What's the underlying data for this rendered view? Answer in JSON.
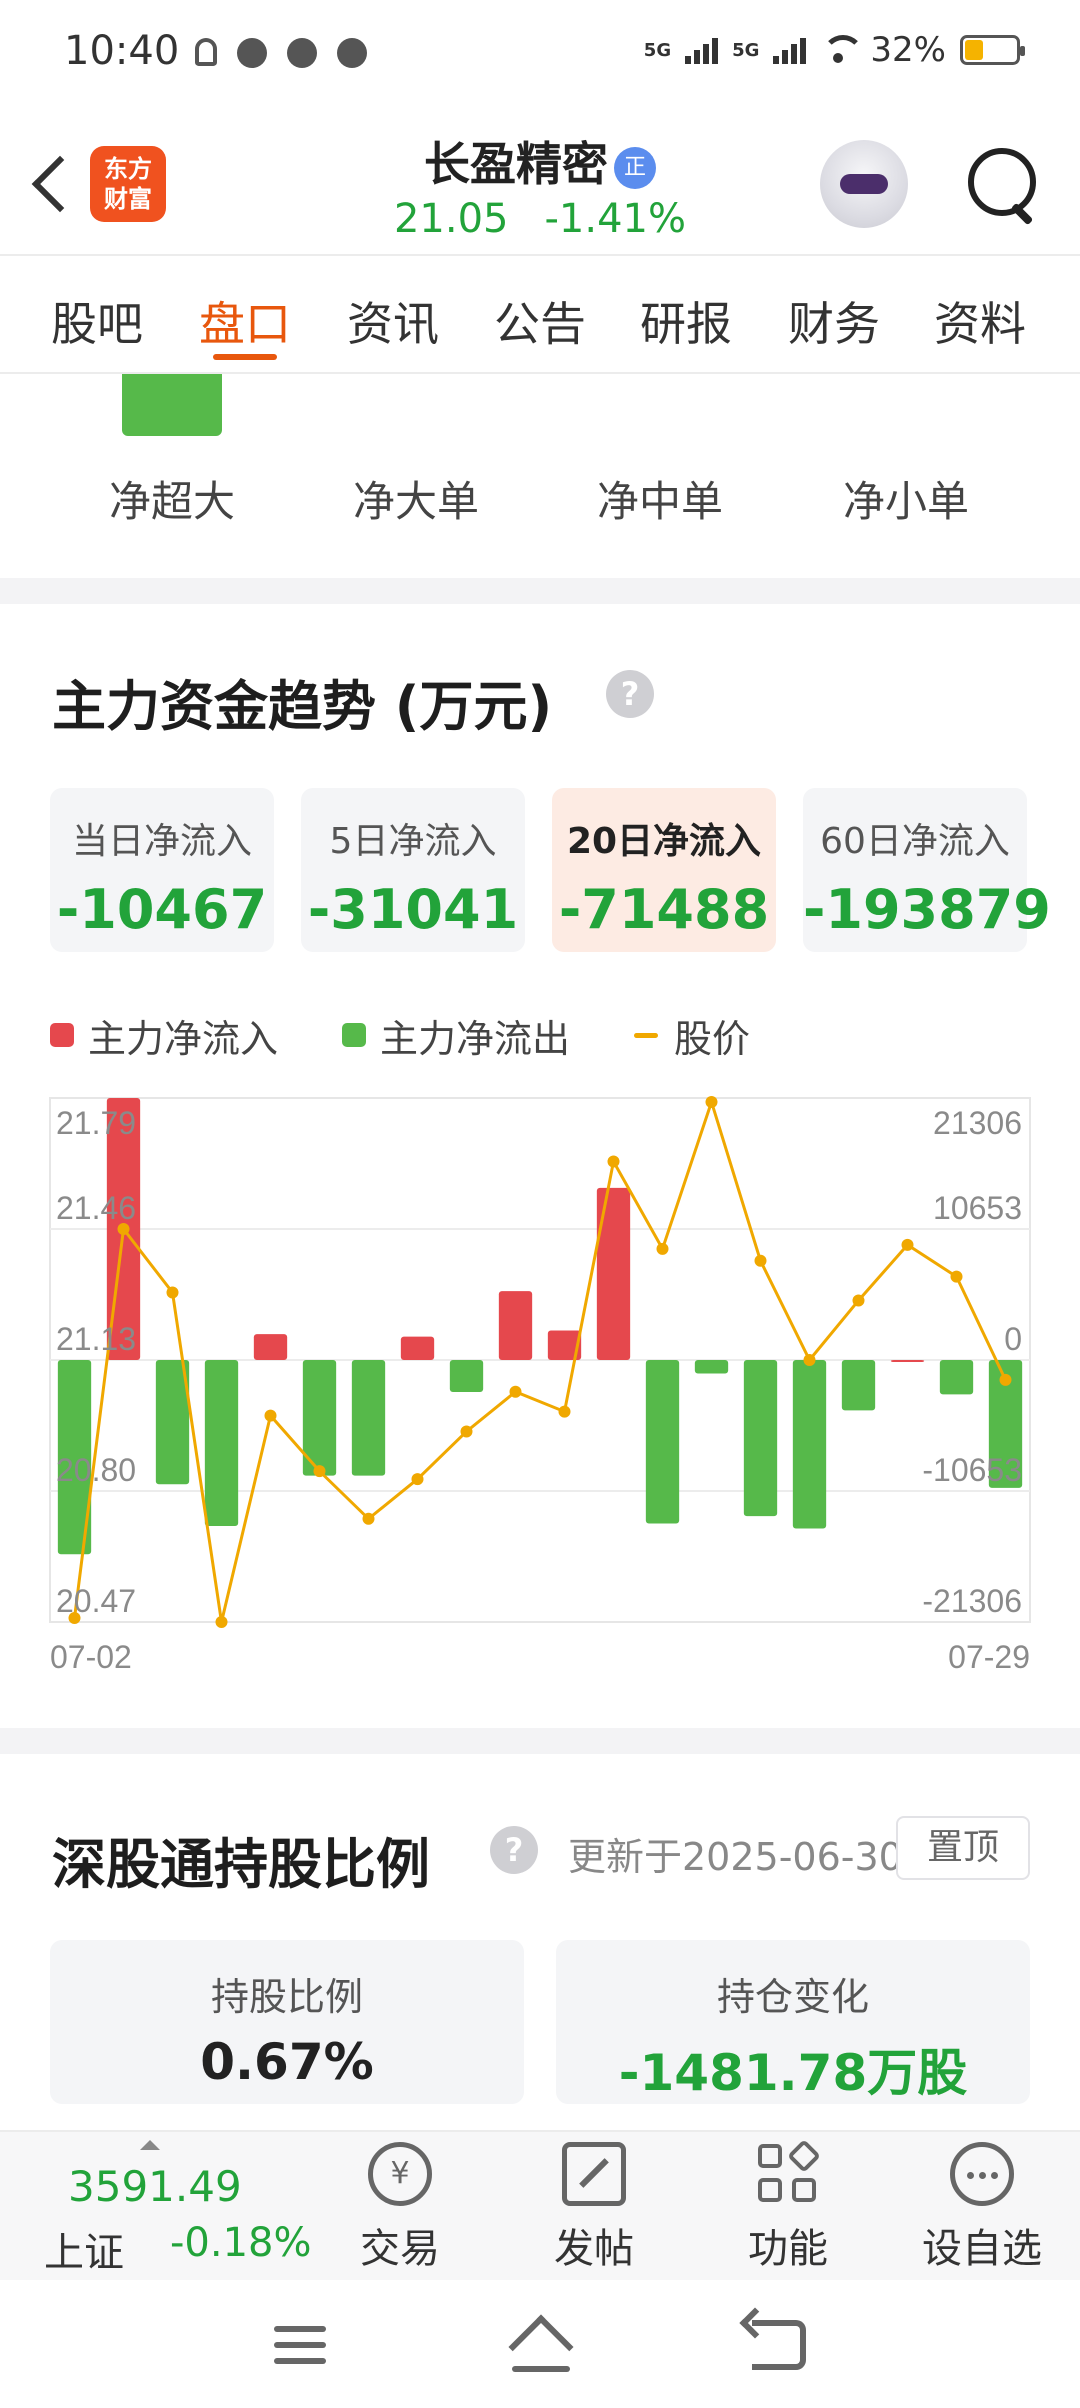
{
  "status_bar": {
    "time": "10:40",
    "signal1": "5G",
    "signal2": "5G",
    "battery": "32%"
  },
  "header": {
    "logo_text_line1": "东方",
    "logo_text_line2": "财富",
    "stock_name": "长盈精密",
    "badge": "正",
    "price": "21.05",
    "change_pct": "-1.41%"
  },
  "tabs": [
    {
      "label": "股吧"
    },
    {
      "label": "盘口"
    },
    {
      "label": "资讯"
    },
    {
      "label": "公告"
    },
    {
      "label": "研报"
    },
    {
      "label": "财务"
    },
    {
      "label": "资料"
    }
  ],
  "active_tab": "盘口",
  "flow_labels": [
    "净超大",
    "净大单",
    "净中单",
    "净小单"
  ],
  "trend": {
    "title": "主力资金趋势 (万元)",
    "help": "?",
    "cards": [
      {
        "label": "当日净流入",
        "value": "-10467"
      },
      {
        "label": "5日净流入",
        "value": "-31041"
      },
      {
        "label": "20日净流入",
        "value": "-71488"
      },
      {
        "label": "60日净流入",
        "value": "-193879"
      }
    ],
    "active_card": "20日净流入",
    "legend": [
      {
        "label": "主力净流入",
        "color": "#e5484d"
      },
      {
        "label": "主力净流出",
        "color": "#56b94a"
      },
      {
        "label": "股价",
        "color": "#f0a800"
      }
    ]
  },
  "chart_data": {
    "type": "bar",
    "x_start_label": "07-02",
    "x_end_label": "07-29",
    "left_ticks": [
      "21.79",
      "21.46",
      "21.13",
      "20.80",
      "20.47"
    ],
    "right_ticks": [
      "21306",
      "10653",
      "0",
      "-10653",
      "-21306"
    ],
    "ylim_flow": [
      -21306,
      21306
    ],
    "ylim_price": [
      20.47,
      21.79
    ],
    "series": [
      {
        "name": "主力净流入/主力净流出",
        "values": [
          -15800,
          21306,
          -10100,
          -13500,
          2100,
          -9400,
          -9400,
          1900,
          -2600,
          5600,
          2400,
          14000,
          -13300,
          -1100,
          -12700,
          -13700,
          -4100,
          0,
          -2800,
          -10400
        ]
      },
      {
        "name": "股价",
        "values": [
          20.48,
          21.46,
          21.3,
          20.47,
          20.99,
          20.85,
          20.73,
          20.83,
          20.95,
          21.05,
          21.0,
          21.63,
          21.41,
          21.78,
          21.38,
          21.13,
          21.28,
          21.42,
          21.34,
          21.08
        ]
      }
    ]
  },
  "holdings": {
    "title": "深股通持股比例",
    "help": "?",
    "updated": "更新于2025-06-30",
    "pin": "置顶",
    "ratio_label": "持股比例",
    "ratio_value": "0.67%",
    "change_label": "持仓变化",
    "change_value": "-1481.78万股"
  },
  "bottom_bar": {
    "index_value": "3591.49",
    "index_name": "上证",
    "index_change": "-0.18%",
    "items": [
      {
        "label": "交易",
        "icon": "trade-icon"
      },
      {
        "label": "发帖",
        "icon": "post-icon"
      },
      {
        "label": "功能",
        "icon": "function-icon"
      },
      {
        "label": "设自选",
        "icon": "add-favorite-icon"
      }
    ]
  }
}
